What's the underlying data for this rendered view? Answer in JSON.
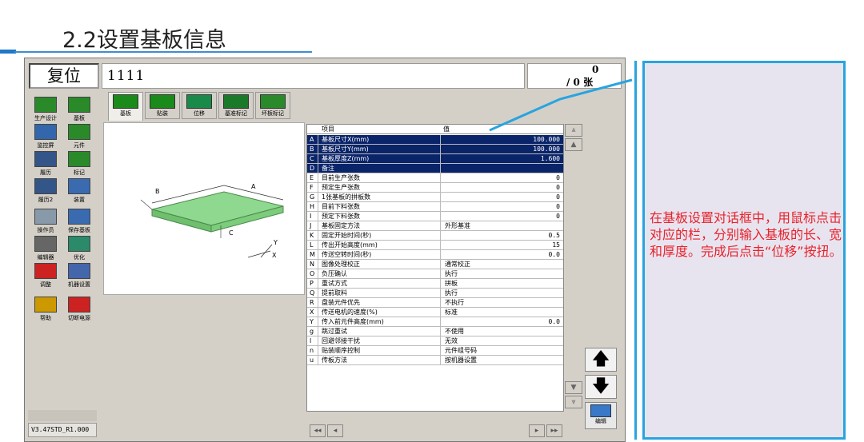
{
  "slide": {
    "title": "2.2设置基板信息",
    "note": "在基板设置对话框中，用鼠标点击对应的栏，分别输入基板的长、宽和厚度。完成后点击“位移”按扭。"
  },
  "app": {
    "status": "复位",
    "program": "1111",
    "count_top": "0",
    "count_bottom": "/ 0 张",
    "version": "V3.47STD_R1.000",
    "left_buttons": [
      {
        "label": "生产设计",
        "icon": "production-design-icon"
      },
      {
        "label": "基板",
        "icon": "board-icon"
      },
      {
        "label": "监控屏",
        "icon": "monitor-icon"
      },
      {
        "label": "元件",
        "icon": "component-icon"
      },
      {
        "label": "履历",
        "icon": "history-icon"
      },
      {
        "label": "标记",
        "icon": "mark-icon"
      },
      {
        "label": "履历2",
        "icon": "history2-icon"
      },
      {
        "label": "装置",
        "icon": "device-icon"
      },
      {
        "label": "操作员",
        "icon": "operator-icon"
      },
      {
        "label": "保存基板",
        "icon": "save-board-icon"
      },
      {
        "label": "编辑器",
        "icon": "editor-icon"
      },
      {
        "label": "优化",
        "icon": "optimize-icon"
      },
      {
        "label": "调整",
        "icon": "adjust-icon"
      },
      {
        "label": "机器设置",
        "icon": "machine-settings-icon"
      },
      {
        "label": "帮助",
        "icon": "help-icon"
      },
      {
        "label": "切断电源",
        "icon": "power-off-icon"
      }
    ],
    "tabs": [
      {
        "label": "基板",
        "icon": "board-tab-icon"
      },
      {
        "label": "贴装",
        "icon": "mount-tab-icon"
      },
      {
        "label": "位移",
        "icon": "offset-tab-icon"
      },
      {
        "label": "基准标记",
        "icon": "fiducial-tab-icon"
      },
      {
        "label": "坏板标记",
        "icon": "bad-mark-tab-icon"
      }
    ],
    "preview_labels": {
      "a": "A",
      "b": "B",
      "c": "C",
      "x": "X",
      "y": "Y"
    },
    "grid": {
      "col_item": "项目",
      "col_value": "值",
      "rows": [
        {
          "key": "A",
          "name": "基板尺寸X(mm)",
          "value": "100.000",
          "num": true,
          "sel": true
        },
        {
          "key": "B",
          "name": "基板尺寸Y(mm)",
          "value": "100.000",
          "num": true,
          "sel": true
        },
        {
          "key": "C",
          "name": "基板厚度Z(mm)",
          "value": "1.600",
          "num": true,
          "sel": true
        },
        {
          "key": "D",
          "name": "备注",
          "value": "",
          "num": false,
          "sel": true
        },
        {
          "key": "E",
          "name": "目前生产张数",
          "value": "0",
          "num": true,
          "sel": false
        },
        {
          "key": "F",
          "name": "预定生产张数",
          "value": "0",
          "num": true,
          "sel": false
        },
        {
          "key": "G",
          "name": "1张基板的拼板数",
          "value": "0",
          "num": true,
          "sel": false
        },
        {
          "key": "H",
          "name": "目前下料张数",
          "value": "0",
          "num": true,
          "sel": false
        },
        {
          "key": "I",
          "name": "预定下料张数",
          "value": "0",
          "num": true,
          "sel": false
        },
        {
          "key": "J",
          "name": "基板固定方法",
          "value": "外形基准",
          "num": false,
          "sel": false
        },
        {
          "key": "K",
          "name": "固定开始时间(秒)",
          "value": "0.5",
          "num": true,
          "sel": false
        },
        {
          "key": "L",
          "name": "传出开始高度(mm)",
          "value": "15",
          "num": true,
          "sel": false
        },
        {
          "key": "M",
          "name": "传送空转时间(秒)",
          "value": "0.0",
          "num": true,
          "sel": false
        },
        {
          "key": "N",
          "name": "图像处理校正",
          "value": "通常校正",
          "num": false,
          "sel": false
        },
        {
          "key": "O",
          "name": "负压确认",
          "value": "执行",
          "num": false,
          "sel": false
        },
        {
          "key": "P",
          "name": "重试方式",
          "value": "拼板",
          "num": false,
          "sel": false
        },
        {
          "key": "Q",
          "name": "提前取料",
          "value": "执行",
          "num": false,
          "sel": false
        },
        {
          "key": "R",
          "name": "盘装元件优先",
          "value": "不执行",
          "num": false,
          "sel": false
        },
        {
          "key": "X",
          "name": "传送电机的速度(%)",
          "value": "标准",
          "num": false,
          "sel": false
        },
        {
          "key": "Y",
          "name": "传入前元件高度(mm)",
          "value": "0.0",
          "num": true,
          "sel": false
        },
        {
          "key": "g",
          "name": "跳过重试",
          "value": "不使用",
          "num": false,
          "sel": false
        },
        {
          "key": "l",
          "name": "回避邻接干扰",
          "value": "无效",
          "num": false,
          "sel": false
        },
        {
          "key": "n",
          "name": "贴装顺序控制",
          "value": "元件组号码",
          "num": false,
          "sel": false
        },
        {
          "key": "u",
          "name": "传板方法",
          "value": "按机器设置",
          "num": false,
          "sel": false
        }
      ]
    },
    "edit_label": "编辑",
    "colors": {
      "selection": "#0a246a",
      "note_border": "#28a4e0",
      "note_text": "#e8222b",
      "board": "#8fd88f"
    }
  }
}
